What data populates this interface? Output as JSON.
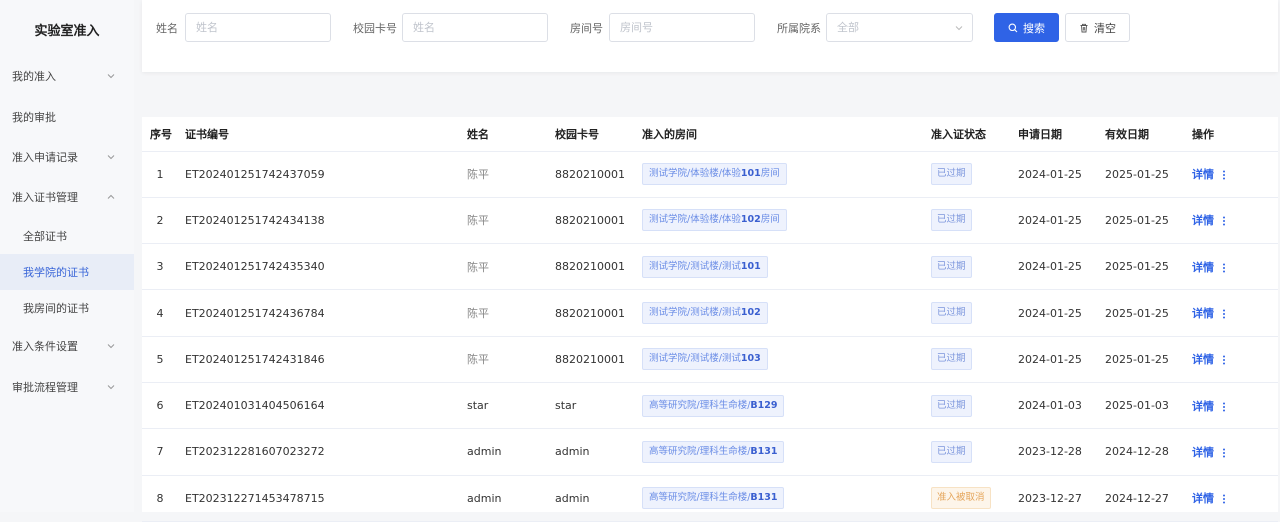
{
  "sidebar": {
    "title": "实验室准入",
    "items": [
      {
        "label": "我的准入",
        "expandable": true,
        "expanded": false
      },
      {
        "label": "我的审批",
        "expandable": false
      },
      {
        "label": "准入申请记录",
        "expandable": true,
        "expanded": false
      },
      {
        "label": "准入证书管理",
        "expandable": true,
        "expanded": true
      },
      {
        "label": "全部证书",
        "sub": true
      },
      {
        "label": "我学院的证书",
        "sub": true,
        "active": true
      },
      {
        "label": "我房间的证书",
        "sub": true
      },
      {
        "label": "准入条件设置",
        "expandable": true,
        "expanded": false
      },
      {
        "label": "审批流程管理",
        "expandable": true,
        "expanded": false
      }
    ]
  },
  "filter": {
    "name_label": "姓名",
    "name_placeholder": "姓名",
    "card_label": "校园卡号",
    "card_placeholder": "姓名",
    "room_label": "房间号",
    "room_placeholder": "房间号",
    "dept_label": "所属院系",
    "dept_value": "全部",
    "search_label": "搜索",
    "clear_label": "清空"
  },
  "table": {
    "headers": [
      "序号",
      "证书编号",
      "姓名",
      "校园卡号",
      "准入的房间",
      "准入证状态",
      "申请日期",
      "有效日期",
      "操作"
    ],
    "rows": [
      {
        "idx": "1",
        "cert": "ET202401251742437059",
        "name": "陈平",
        "card": "8820210001",
        "room_pre": "测试学院/体验楼/体验",
        "room_num": "101",
        "room_post": "房间",
        "status": "已过期",
        "apply": "2024-01-25",
        "valid": "2025-01-25",
        "op": "详情"
      },
      {
        "idx": "2",
        "cert": "ET202401251742434138",
        "name": "陈平",
        "card": "8820210001",
        "room_pre": "测试学院/体验楼/体验",
        "room_num": "102",
        "room_post": "房间",
        "status": "已过期",
        "apply": "2024-01-25",
        "valid": "2025-01-25",
        "op": "详情"
      },
      {
        "idx": "3",
        "cert": "ET202401251742435340",
        "name": "陈平",
        "card": "8820210001",
        "room_pre": "测试学院/测试楼/测试",
        "room_num": "101",
        "room_post": "",
        "status": "已过期",
        "apply": "2024-01-25",
        "valid": "2025-01-25",
        "op": "详情"
      },
      {
        "idx": "4",
        "cert": "ET202401251742436784",
        "name": "陈平",
        "card": "8820210001",
        "room_pre": "测试学院/测试楼/测试",
        "room_num": "102",
        "room_post": "",
        "status": "已过期",
        "apply": "2024-01-25",
        "valid": "2025-01-25",
        "op": "详情"
      },
      {
        "idx": "5",
        "cert": "ET202401251742431846",
        "name": "陈平",
        "card": "8820210001",
        "room_pre": "测试学院/测试楼/测试",
        "room_num": "103",
        "room_post": "",
        "status": "已过期",
        "apply": "2024-01-25",
        "valid": "2025-01-25",
        "op": "详情"
      },
      {
        "idx": "6",
        "cert": "ET202401031404506164",
        "name": "star",
        "card": "star",
        "room_pre": "高等研究院/理科生命楼/",
        "room_num": "B129",
        "room_post": "",
        "status": "已过期",
        "apply": "2024-01-03",
        "valid": "2025-01-03",
        "op": "详情"
      },
      {
        "idx": "7",
        "cert": "ET202312281607023272",
        "name": "admin",
        "card": "admin",
        "room_pre": "高等研究院/理科生命楼/",
        "room_num": "B131",
        "room_post": "",
        "status": "已过期",
        "apply": "2023-12-28",
        "valid": "2024-12-28",
        "op": "详情"
      },
      {
        "idx": "8",
        "cert": "ET202312271453478715",
        "name": "admin",
        "card": "admin",
        "room_pre": "高等研究院/理科生命楼/",
        "room_num": "B131",
        "room_post": "",
        "status": "准入被取消",
        "status_warn": true,
        "apply": "2023-12-27",
        "valid": "2024-12-27",
        "op": "详情"
      }
    ]
  },
  "colors": {
    "primary": "#2f63e6",
    "active_bg": "#e8edf7",
    "tag_bg": "#eef2fd",
    "warn_text": "#e5a65c"
  }
}
